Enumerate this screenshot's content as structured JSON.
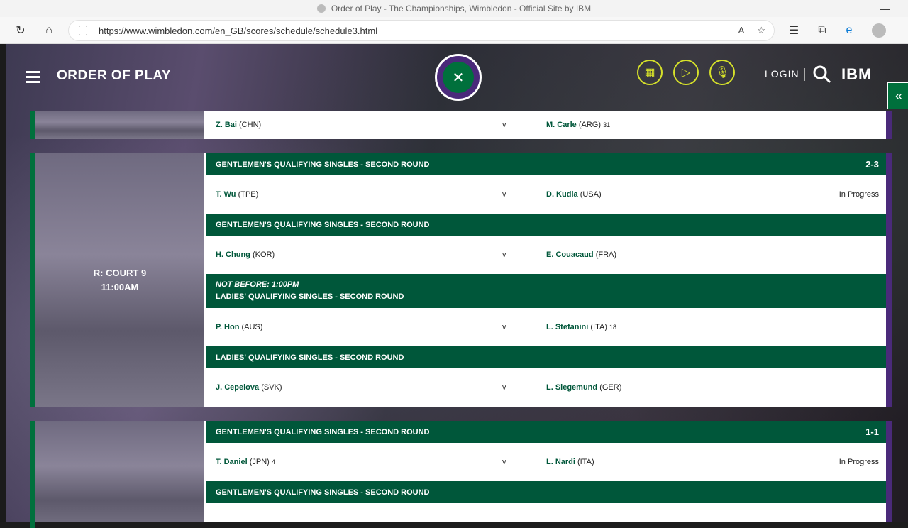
{
  "browser": {
    "tab_title": "Order of Play - The Championships, Wimbledon - Official Site by IBM",
    "url": "https://www.wimbledon.com/en_GB/scores/schedule/schedule3.html"
  },
  "header": {
    "title": "ORDER OF PLAY",
    "login": "LOGIN",
    "ibm": "IBM"
  },
  "top_partial": {
    "player1": "Z. Bai",
    "player1_country": "(CHN)",
    "vs": "v",
    "player2": "M. Carle",
    "player2_country": "(ARG)",
    "player2_seed": "31"
  },
  "court1": {
    "name": "R: COURT 9",
    "time": "11:00AM",
    "matches": [
      {
        "round": "GENTLEMEN'S QUALIFYING SINGLES - SECOND ROUND",
        "not_before": "",
        "score": "2-3",
        "p1": "T. Wu",
        "p1_country": "(TPE)",
        "p1_seed": "",
        "vs": "v",
        "p2": "D. Kudla",
        "p2_country": "(USA)",
        "p2_seed": "",
        "status": "In Progress"
      },
      {
        "round": "GENTLEMEN'S QUALIFYING SINGLES - SECOND ROUND",
        "not_before": "",
        "score": "",
        "p1": "H. Chung",
        "p1_country": "(KOR)",
        "p1_seed": "",
        "vs": "v",
        "p2": "E. Couacaud",
        "p2_country": "(FRA)",
        "p2_seed": "",
        "status": ""
      },
      {
        "round": "LADIES' QUALIFYING SINGLES - SECOND ROUND",
        "not_before": "NOT BEFORE: 1:00PM",
        "score": "",
        "p1": "P. Hon",
        "p1_country": "(AUS)",
        "p1_seed": "",
        "vs": "v",
        "p2": "L. Stefanini",
        "p2_country": "(ITA)",
        "p2_seed": "18",
        "status": ""
      },
      {
        "round": "LADIES' QUALIFYING SINGLES - SECOND ROUND",
        "not_before": "",
        "score": "",
        "p1": "J. Cepelova",
        "p1_country": "(SVK)",
        "p1_seed": "",
        "vs": "v",
        "p2": "L. Siegemund",
        "p2_country": "(GER)",
        "p2_seed": "",
        "status": ""
      }
    ]
  },
  "court2": {
    "matches": [
      {
        "round": "GENTLEMEN'S QUALIFYING SINGLES - SECOND ROUND",
        "score": "1-1",
        "p1": "T. Daniel",
        "p1_country": "(JPN)",
        "p1_seed": "4",
        "vs": "v",
        "p2": "L. Nardi",
        "p2_country": "(ITA)",
        "p2_seed": "",
        "status": "In Progress"
      },
      {
        "round": "GENTLEMEN'S QUALIFYING SINGLES - SECOND ROUND",
        "score": ""
      }
    ]
  },
  "colors": {
    "green": "#00703c",
    "dark_green": "#00573a",
    "purple": "#4a2a7a",
    "accent": "#d6e12a"
  }
}
